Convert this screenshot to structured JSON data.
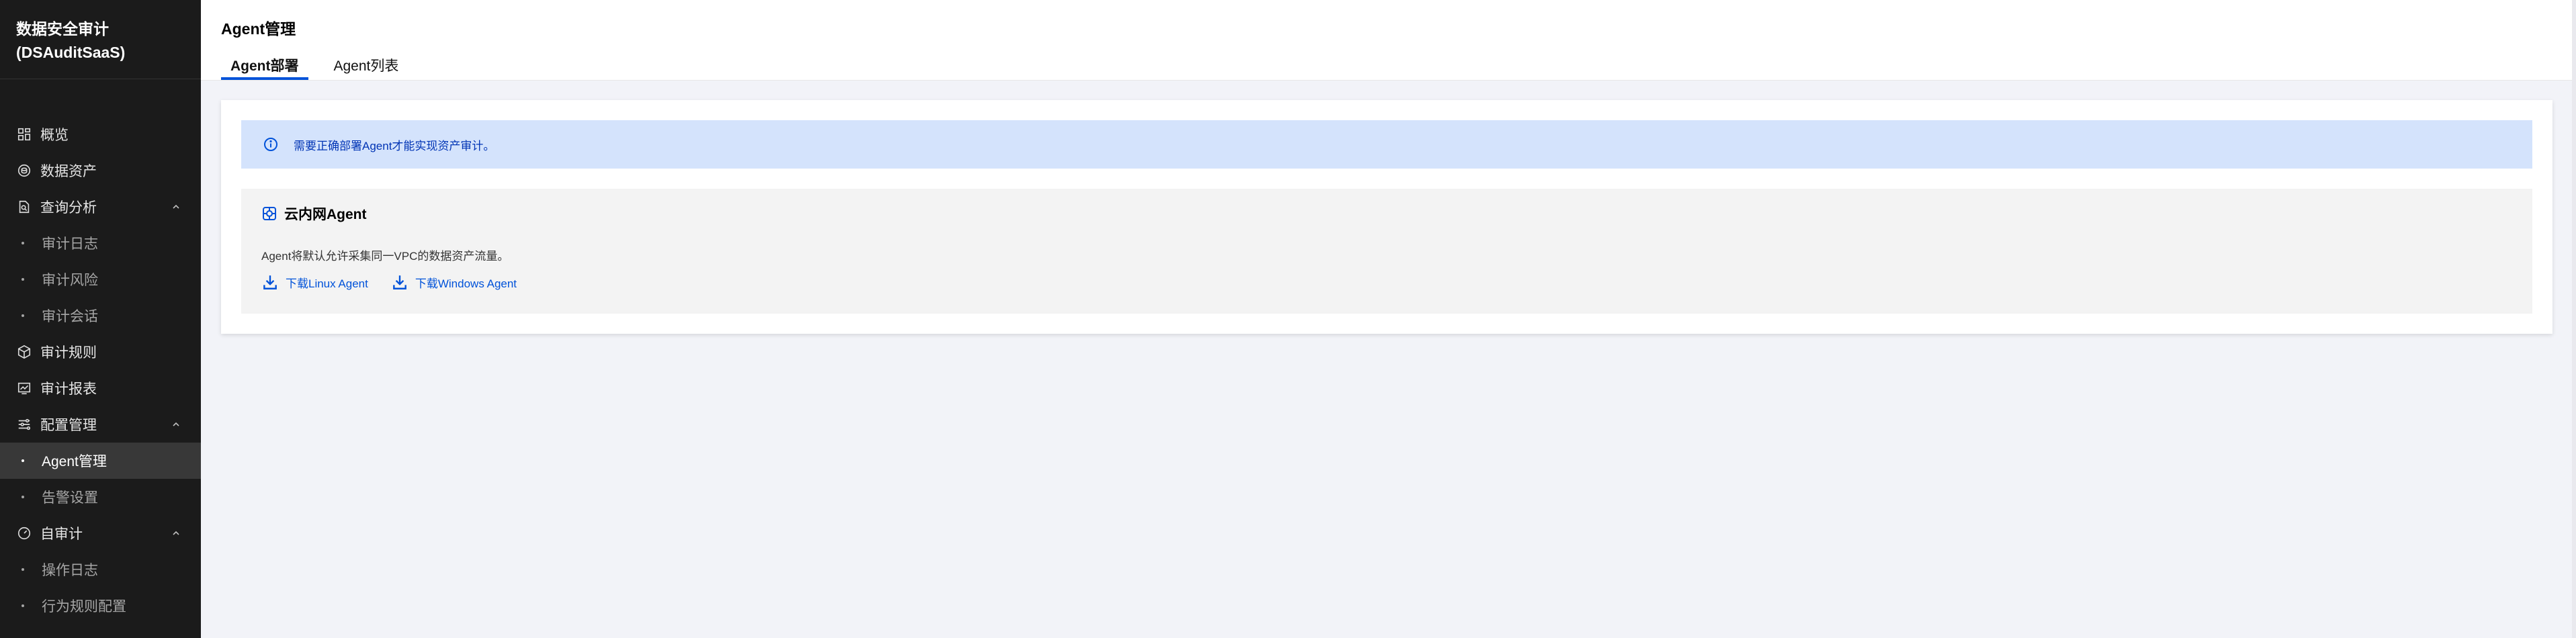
{
  "sidebar": {
    "brand_line1": "数据安全审计",
    "brand_line2": "(DSAuditSaaS)",
    "items": [
      {
        "label": "概览",
        "icon": "dashboard-icon"
      },
      {
        "label": "数据资产",
        "icon": "database-icon"
      },
      {
        "label": "查询分析",
        "icon": "search-doc-icon",
        "expanded": true,
        "children": [
          "审计日志",
          "审计风险",
          "审计会话"
        ]
      },
      {
        "label": "审计规则",
        "icon": "cube-icon"
      },
      {
        "label": "审计报表",
        "icon": "chart-icon"
      },
      {
        "label": "配置管理",
        "icon": "sliders-icon",
        "expanded": true,
        "children": [
          "Agent管理",
          "告警设置"
        ],
        "active_child": "Agent管理"
      },
      {
        "label": "自审计",
        "icon": "gauge-icon",
        "expanded": true,
        "children": [
          "操作日志",
          "行为规则配置"
        ]
      }
    ]
  },
  "header": {
    "title": "Agent管理",
    "tabs": [
      "Agent部署",
      "Agent列表"
    ],
    "active_tab": "Agent部署"
  },
  "alert": {
    "text": "需要正确部署Agent才能实现资产审计。",
    "icon": "info-icon"
  },
  "agent_section": {
    "title": "云内网Agent",
    "icon": "network-icon",
    "description": "Agent将默认允许采集同一VPC的数据资产流量。",
    "downloads": [
      "下载Linux Agent",
      "下载Windows Agent"
    ],
    "download_icon": "download-icon"
  },
  "colors": {
    "sidebar_bg": "#1b1b1b",
    "brand_blue": "#0052d9",
    "alert_bg": "#d4e3fc",
    "page_bg": "#f2f3f8"
  }
}
